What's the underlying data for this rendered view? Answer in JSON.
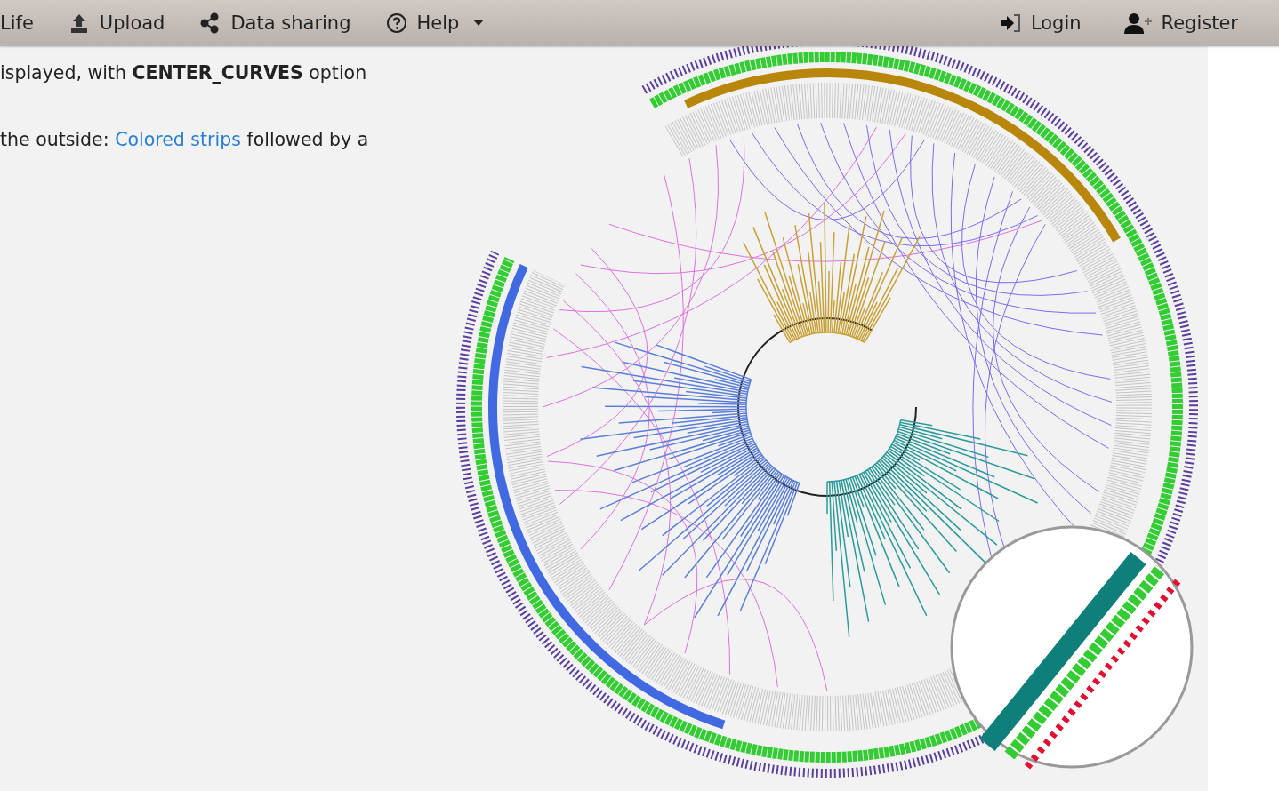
{
  "nav": {
    "left": [
      {
        "label": "Life"
      },
      {
        "label": "Upload"
      },
      {
        "label": "Data sharing"
      },
      {
        "label": "Help"
      }
    ],
    "right": [
      {
        "label": "Login"
      },
      {
        "label": "Register"
      }
    ]
  },
  "paragraphs": [
    [
      [
        {
          "kind": "text",
          "text": "isplayed, with **CENTER_CURVES** option"
        }
      ]
    ],
    [
      [
        {
          "kind": "text",
          "text": "the outside: "
        },
        {
          "kind": "link",
          "text": "Colored strips"
        },
        {
          "kind": "text",
          "text": " followed by a"
        }
      ]
    ]
  ],
  "figure": {
    "kind": "picture"
  }
}
